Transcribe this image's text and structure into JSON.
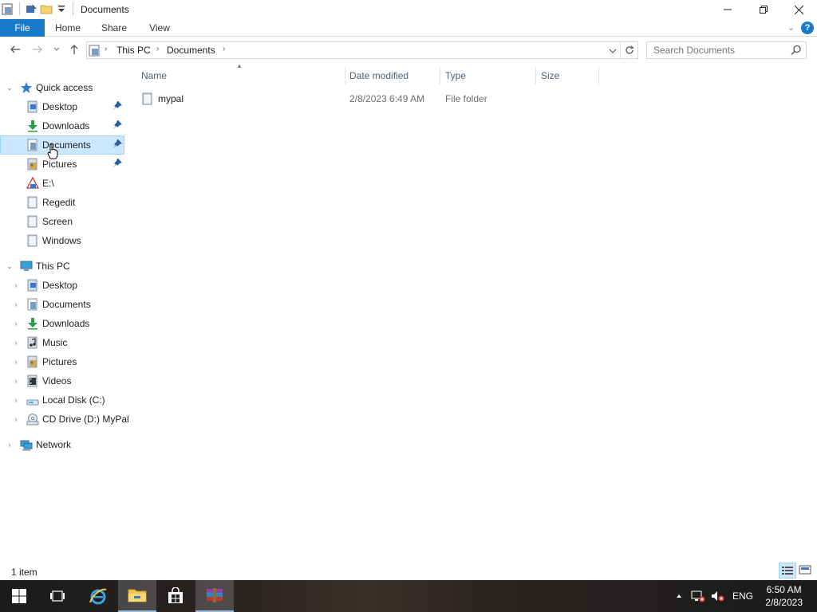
{
  "window": {
    "title": "Documents"
  },
  "ribbon": {
    "tabs": [
      "File",
      "Home",
      "Share",
      "View"
    ]
  },
  "address": {
    "crumbs": [
      "This PC",
      "Documents"
    ]
  },
  "search": {
    "placeholder": "Search Documents"
  },
  "nav": {
    "quick_access_label": "Quick access",
    "quick_access": [
      {
        "label": "Desktop",
        "icon": "desktop-icon",
        "pinned": true
      },
      {
        "label": "Downloads",
        "icon": "downloads-icon",
        "pinned": true
      },
      {
        "label": "Documents",
        "icon": "documents-icon",
        "pinned": true,
        "selected": true
      },
      {
        "label": "Pictures",
        "icon": "pictures-icon",
        "pinned": true
      },
      {
        "label": "E:\\",
        "icon": "drive-e-icon"
      },
      {
        "label": "Regedit",
        "icon": "folder-icon"
      },
      {
        "label": "Screen",
        "icon": "folder-icon"
      },
      {
        "label": "Windows",
        "icon": "folder-icon"
      }
    ],
    "this_pc_label": "This PC",
    "this_pc": [
      {
        "label": "Desktop",
        "icon": "desktop-icon"
      },
      {
        "label": "Documents",
        "icon": "documents-icon"
      },
      {
        "label": "Downloads",
        "icon": "downloads-icon"
      },
      {
        "label": "Music",
        "icon": "music-icon"
      },
      {
        "label": "Pictures",
        "icon": "pictures-icon"
      },
      {
        "label": "Videos",
        "icon": "videos-icon"
      },
      {
        "label": "Local Disk (C:)",
        "icon": "local-disk-icon"
      },
      {
        "label": "CD Drive (D:) MyPal",
        "icon": "cd-drive-icon"
      }
    ],
    "network_label": "Network"
  },
  "columns": [
    "Name",
    "Date modified",
    "Type",
    "Size"
  ],
  "files": [
    {
      "name": "mypal",
      "date": "2/8/2023 6:49 AM",
      "type": "File folder",
      "size": ""
    }
  ],
  "status": {
    "count": "1 item"
  },
  "tray": {
    "lang": "ENG",
    "time": "6:50 AM",
    "date": "2/8/2023"
  },
  "colors": {
    "accent": "#1979ca",
    "selection": "#cce8ff",
    "folder": "#e8c46a"
  }
}
